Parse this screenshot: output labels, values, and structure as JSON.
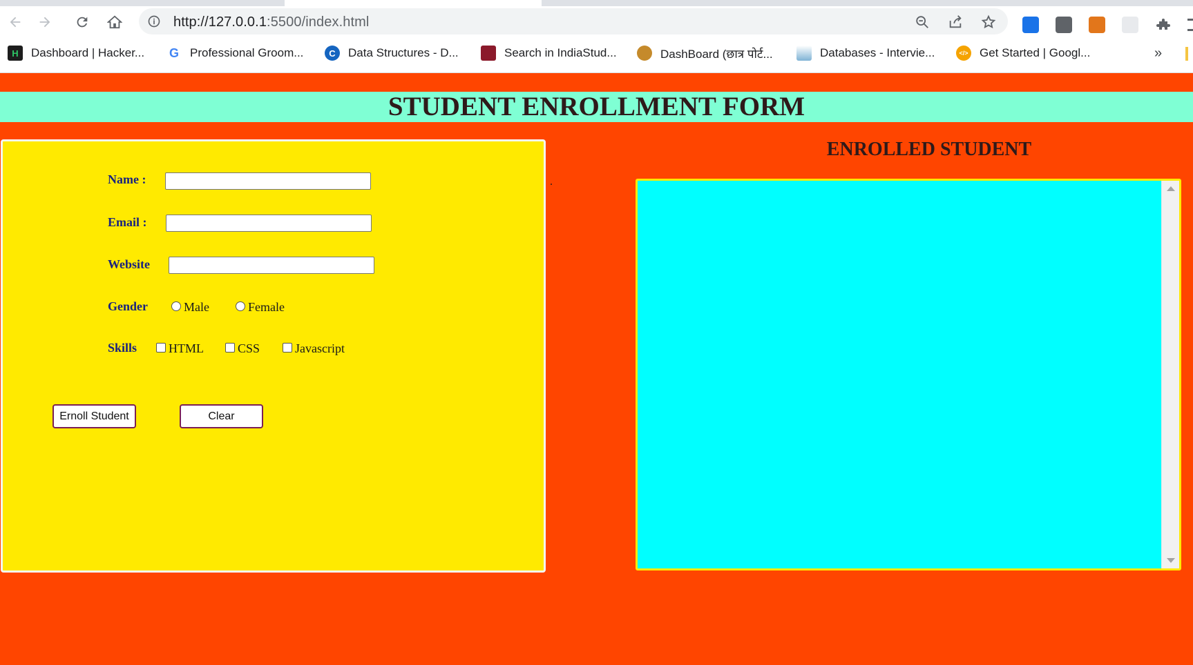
{
  "browser": {
    "url_host": "http://127.0.0.1",
    "url_rest": ":5500/index.html",
    "bookmarks": [
      {
        "label": "Dashboard | Hacker...",
        "icon": "hackerrank-icon",
        "color": "#1d1d1d",
        "glyph": "H"
      },
      {
        "label": "Professional Groom...",
        "icon": "google-icon",
        "color": "#ffffff",
        "glyph": "G"
      },
      {
        "label": "Data Structures - D...",
        "icon": "codechef-icon",
        "color": "#1565c0",
        "glyph": "C"
      },
      {
        "label": "Search in IndiaStud...",
        "icon": "book-icon",
        "color": "#8b1a2b",
        "glyph": ""
      },
      {
        "label": "DashBoard (छात्र पोर्ट...",
        "icon": "emblem-icon",
        "color": "#c58a2b",
        "glyph": ""
      },
      {
        "label": "Databases - Intervie...",
        "icon": "pyramid-icon",
        "color": "#7fb3d5",
        "glyph": ""
      },
      {
        "label": "Get Started | Googl...",
        "icon": "gdsc-icon",
        "color": "#f5a300",
        "glyph": "</>"
      }
    ],
    "more_label": "»"
  },
  "page": {
    "title": "STUDENT ENROLLMENT FORM",
    "form": {
      "name_label": "Name :",
      "email_label": "Email :",
      "website_label": "Website",
      "gender_label": "Gender",
      "gender_options": [
        "Male",
        "Female"
      ],
      "skills_label": "Skills",
      "skill_options": [
        "HTML",
        "CSS",
        "Javascript"
      ],
      "enroll_button": "Ernoll Student",
      "clear_button": "Clear"
    },
    "stray_text": ".",
    "enrolled_title": "ENROLLED STUDENT"
  },
  "colors": {
    "page_bg": "#ff4500",
    "title_bg": "#7fffd4",
    "form_bg": "#ffea00",
    "enrolled_bg": "#00ffff"
  }
}
